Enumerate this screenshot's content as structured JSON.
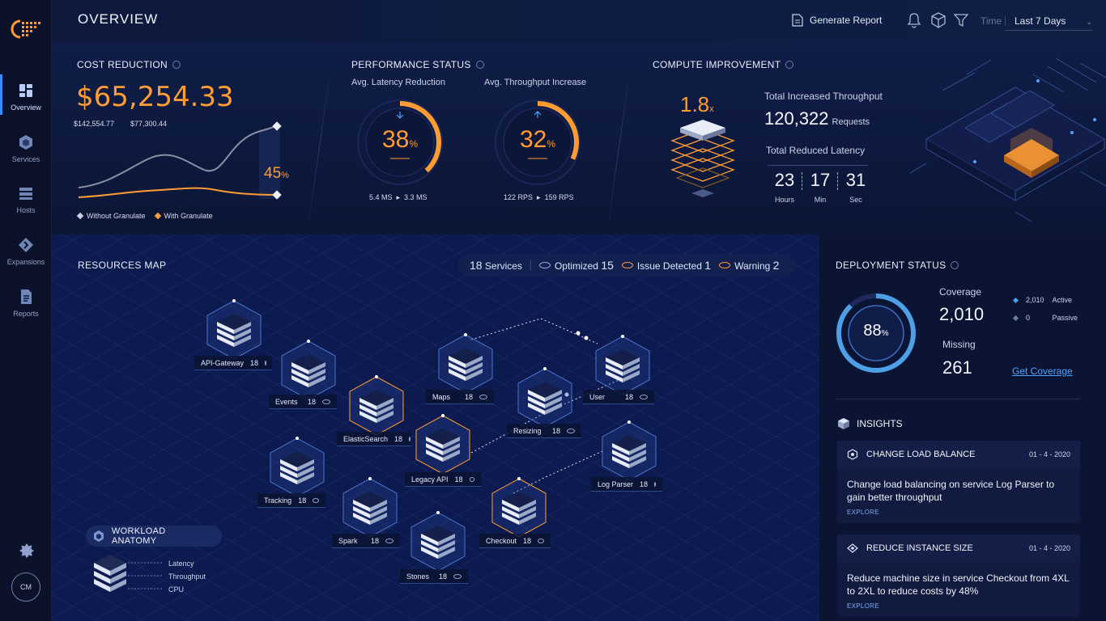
{
  "sidebar": {
    "items": [
      {
        "label": "Overview",
        "icon": "dashboard-icon"
      },
      {
        "label": "Services",
        "icon": "hexagon-icon"
      },
      {
        "label": "Hosts",
        "icon": "server-icon"
      },
      {
        "label": "Expansions",
        "icon": "arrow-diamond-icon"
      },
      {
        "label": "Reports",
        "icon": "document-icon"
      }
    ],
    "user_initials": "CM"
  },
  "header": {
    "title": "OVERVIEW",
    "generate_report": "Generate Report",
    "time_label": "Time",
    "time_value": "Last 7 Days"
  },
  "cost": {
    "title": "COST REDUCTION",
    "value": "$65,254.33",
    "without": "$142,554.77",
    "with": "$77,300.44",
    "percent": "45",
    "percent_unit": "%",
    "legend_without": "Without Granulate",
    "legend_with": "With Granulate"
  },
  "performance": {
    "title": "PERFORMANCE STATUS",
    "latency_label": "Avg. Latency Reduction",
    "latency_value": "38",
    "latency_progress": 0.38,
    "latency_from": "5.4 MS",
    "latency_to": "3.3 MS",
    "throughput_label": "Avg. Throughput Increase",
    "throughput_value": "32",
    "throughput_progress": 0.32,
    "throughput_from": "122 RPS",
    "throughput_to": "159 RPS",
    "unit": "%"
  },
  "compute": {
    "title": "COMPUTE IMPROVEMENT",
    "multiplier": "1.8",
    "multiplier_unit": "x",
    "throughput_label": "Total Increased Throughput",
    "throughput_value": "120,322",
    "throughput_unit": "Requests",
    "latency_label": "Total Reduced Latency",
    "hours": "23",
    "minutes": "17",
    "seconds": "31",
    "hours_label": "Hours",
    "minutes_label": "Min",
    "seconds_label": "Sec"
  },
  "resources": {
    "title": "RESOURCES MAP",
    "services_count": "18",
    "services_label": "Services",
    "optimized_label": "Optimized",
    "optimized_count": "15",
    "issue_label": "Issue Detected",
    "issue_count": "1",
    "warning_label": "Warning",
    "warning_count": "2",
    "nodes": [
      {
        "name": "API-Gateway",
        "count": "18"
      },
      {
        "name": "Events",
        "count": "18"
      },
      {
        "name": "ElasticSearch",
        "count": "18"
      },
      {
        "name": "Maps",
        "count": "18"
      },
      {
        "name": "Resizing",
        "count": "18"
      },
      {
        "name": "User",
        "count": "18"
      },
      {
        "name": "Legacy API",
        "count": "18"
      },
      {
        "name": "Tracking",
        "count": "18"
      },
      {
        "name": "Log Parser",
        "count": "18"
      },
      {
        "name": "Spark",
        "count": "18"
      },
      {
        "name": "Checkout",
        "count": "18"
      },
      {
        "name": "Stones",
        "count": "18"
      }
    ],
    "workload_title": "WORKLOAD ANATOMY",
    "workload_items": [
      "Latency",
      "Throughput",
      "CPU"
    ]
  },
  "deployment": {
    "title": "DEPLOYMENT STATUS",
    "percent": "88",
    "percent_unit": "%",
    "progress": 0.88,
    "coverage_label": "Coverage",
    "coverage_value": "2,010",
    "missing_label": "Missing",
    "missing_value": "261",
    "active_count": "2,010",
    "active_label": "Active",
    "passive_count": "0",
    "passive_label": "Passive",
    "get_coverage": "Get Coverage"
  },
  "insights": {
    "title": "INSIGHTS",
    "cards": [
      {
        "title": "CHANGE LOAD BALANCE",
        "date": "01 - 4 - 2020",
        "body": "Change load balancing on service Log Parser to gain better throughput",
        "link": "EXPLORE"
      },
      {
        "title": "REDUCE INSTANCE SIZE",
        "date": "01 - 4 - 2020",
        "body": "Reduce machine size in service Checkout from 4XL to 2XL to reduce costs by 48%",
        "link": "EXPLORE"
      }
    ]
  },
  "colors": {
    "accent": "#ff9c33",
    "link": "#4da4ff",
    "background": "#0a1430"
  }
}
